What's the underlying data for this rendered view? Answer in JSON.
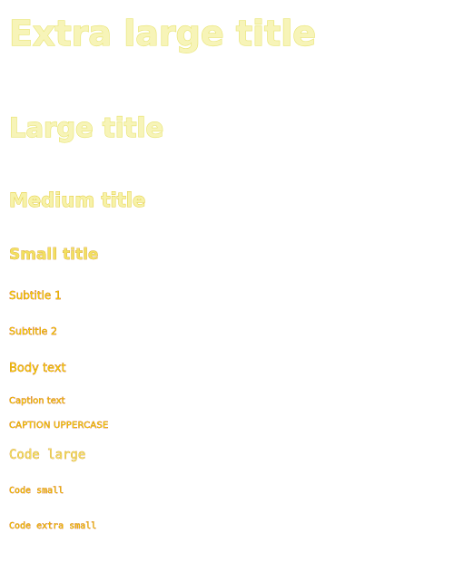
{
  "typography": {
    "extra_large_title": "Extra large title",
    "large_title": "Large title",
    "medium_title": "Medium title",
    "small_title": "Small title",
    "subtitle_1": "Subtitle 1",
    "subtitle_2": "Subtitle 2",
    "body_text": "Body text",
    "caption_text": "Caption text",
    "caption_uppercase": "CAPTION UPPERCASE",
    "code_large": "Code large",
    "code_small": "Code small",
    "code_extra_small": "Code extra small"
  },
  "colors": {
    "ghost_fill": "#f7f4b8",
    "ghost_halo_yellow": "#e8e470",
    "ghost_halo_orange": "#c87a10",
    "ghost_halo_red": "#c02000"
  }
}
